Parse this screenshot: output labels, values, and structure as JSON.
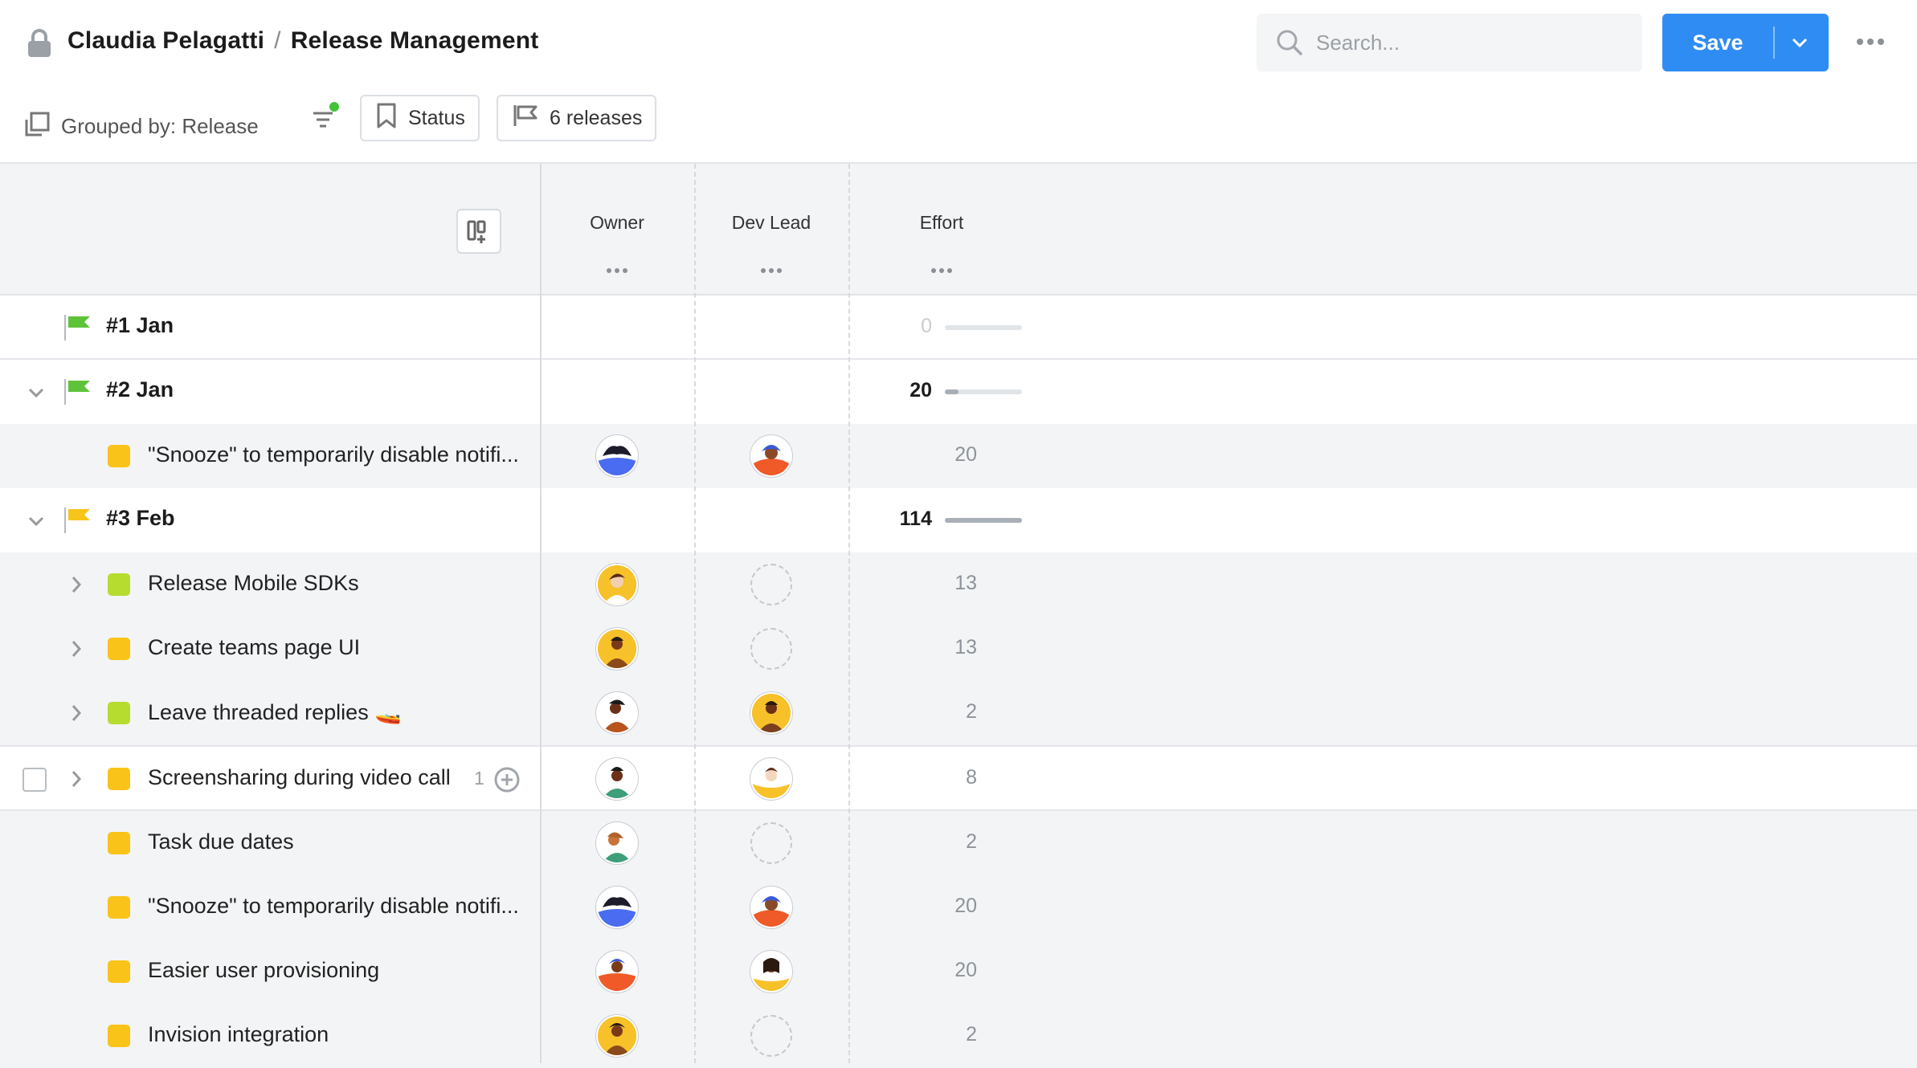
{
  "header": {
    "owner_name": "Claudia Pelagatti",
    "separator": "/",
    "page_name": "Release Management",
    "search_placeholder": "Search...",
    "save_label": "Save"
  },
  "toolbar": {
    "grouped_by": "Grouped by: Release",
    "status_label": "Status",
    "releases_label": "6 releases"
  },
  "columns": {
    "owner": "Owner",
    "dev_lead": "Dev Lead",
    "effort": "Effort",
    "menu_glyph": "•••"
  },
  "colors": {
    "accent": "#2f8cf3",
    "flag_green": "#5fc33a",
    "flag_yellow": "#f7c419",
    "status_lime": "#b6dc2f",
    "status_yellow": "#f9c31a"
  },
  "groups": [
    {
      "title": "#1 Jan",
      "effort": "0",
      "flag": "green",
      "progress": 0
    },
    {
      "title": "#2 Jan",
      "effort": "20",
      "flag": "green",
      "progress": 0.18
    },
    {
      "title": "#3 Feb",
      "effort": "114",
      "flag": "yellow",
      "progress": 1.0
    }
  ],
  "items": [
    {
      "title": "\"Snooze\" to temporarily disable notifi...",
      "effort": "20",
      "status": "yellow"
    },
    {
      "title": "Release Mobile SDKs",
      "effort": "13",
      "status": "lime"
    },
    {
      "title": "Create teams page UI",
      "effort": "13",
      "status": "yellow"
    },
    {
      "title": "Leave threaded replies 🚤",
      "effort": "2",
      "status": "lime"
    },
    {
      "title": "Screensharing during video call",
      "effort": "8",
      "status": "yellow",
      "count": "1"
    },
    {
      "title": "Task due dates",
      "effort": "2",
      "status": "yellow"
    },
    {
      "title": "\"Snooze\" to temporarily disable notifi...",
      "effort": "20",
      "status": "yellow"
    },
    {
      "title": "Easier user provisioning",
      "effort": "20",
      "status": "yellow"
    },
    {
      "title": "Invision integration",
      "effort": "2",
      "status": "yellow"
    }
  ]
}
